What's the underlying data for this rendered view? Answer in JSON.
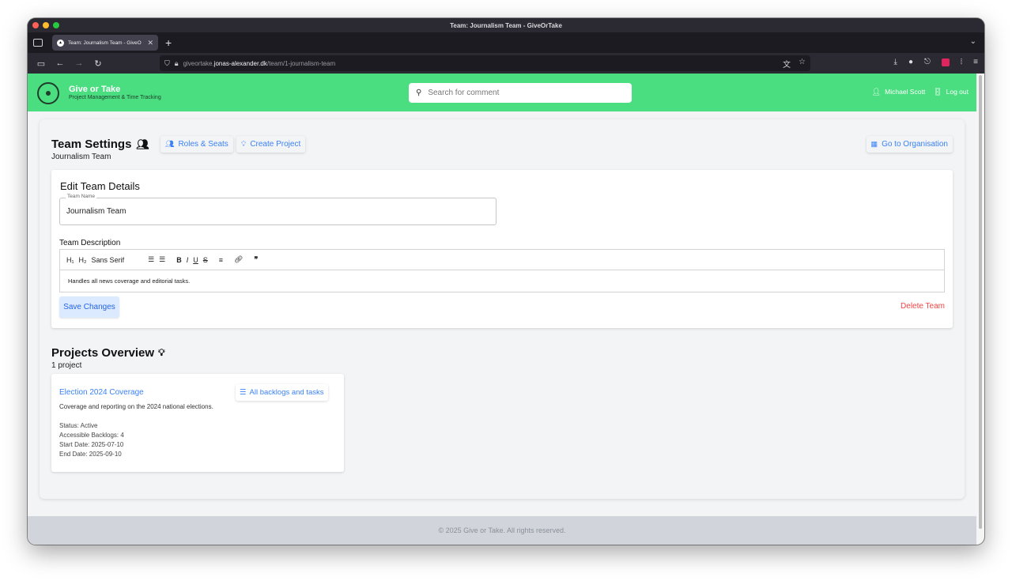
{
  "window": {
    "title": "Team: Journalism Team - GiveOrTake"
  },
  "tab": {
    "title": "Team: Journalism Team - GiveO",
    "favicon_icon": "givetake-favicon-icon"
  },
  "address": {
    "domain_prefix": "giveortake.",
    "domain": "jonas-alexander.dk",
    "path": "/team/1-journalism-team"
  },
  "header": {
    "brand_name": "Give or Take",
    "brand_tagline": "Project Management & Time Tracking",
    "search_placeholder": "Search for comment",
    "user_name": "Michael Scott",
    "logout_label": "Log out",
    "accent_color": "#4ade80"
  },
  "team_settings": {
    "title": "Team Settings",
    "team_name_sub": "Journalism Team",
    "roles_label": "Roles & Seats",
    "create_project_label": "Create Project",
    "go_org_label": "Go to Organisation"
  },
  "edit_team": {
    "title": "Edit Team Details",
    "team_name_label": "Team Name",
    "team_name_value": "Journalism Team",
    "description_label": "Team Description",
    "toolbar": {
      "h1": "H₁",
      "h2": "H₂",
      "font": "Sans Serif",
      "bold": "B",
      "italic": "I",
      "underline": "U",
      "strike": "S",
      "quote": "❞"
    },
    "description_value": "Handles all news coverage and editorial tasks.",
    "save_label": "Save Changes",
    "delete_label": "Delete Team"
  },
  "projects": {
    "title": "Projects Overview",
    "count_text": "1 project",
    "items": [
      {
        "name": "Election 2024 Coverage",
        "backlog_label": "All backlogs and tasks",
        "description": "Coverage and reporting on the 2024 national elections.",
        "status": "Status: Active",
        "backlogs": "Accessible Backlogs: 4",
        "start": "Start Date: 2025-07-10",
        "end": "End Date: 2025-09-10"
      }
    ]
  },
  "footer": {
    "text": "© 2025 Give or Take. All rights reserved."
  }
}
